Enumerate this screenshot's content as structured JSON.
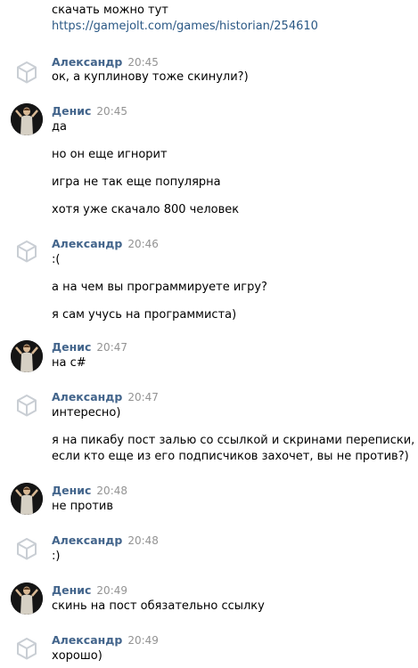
{
  "top": {
    "line1": "скачать можно тут",
    "link": "https://gamejolt.com/games/historian/254610"
  },
  "messages": [
    {
      "author": "Александр",
      "time": "20:45",
      "lines": [
        "ок, а куплинову тоже скинули?)"
      ]
    },
    {
      "author": "Денис",
      "time": "20:45",
      "lines": [
        "да",
        "но он еще игнорит",
        "игра не так еще популярна",
        "хотя уже скачало 800 человек"
      ]
    },
    {
      "author": "Александр",
      "time": "20:46",
      "lines": [
        ":(",
        "а на чем вы программируете игру?",
        "я сам учусь на программиста)"
      ]
    },
    {
      "author": "Денис",
      "time": "20:47",
      "lines": [
        "на с#"
      ]
    },
    {
      "author": "Александр",
      "time": "20:47",
      "lines": [
        "интересно)",
        "я на пикабу пост залью со ссылкой и скринами переписки,",
        "если кто еще из его подписчиков захочет, вы не против?)"
      ]
    },
    {
      "author": "Денис",
      "time": "20:48",
      "lines": [
        "не против"
      ]
    },
    {
      "author": "Александр",
      "time": "20:48",
      "lines": [
        ":)"
      ]
    },
    {
      "author": "Денис",
      "time": "20:49",
      "lines": [
        "скинь на пост обязательно ссылку"
      ]
    },
    {
      "author": "Александр",
      "time": "20:49",
      "lines": [
        "хорошо)"
      ]
    }
  ]
}
